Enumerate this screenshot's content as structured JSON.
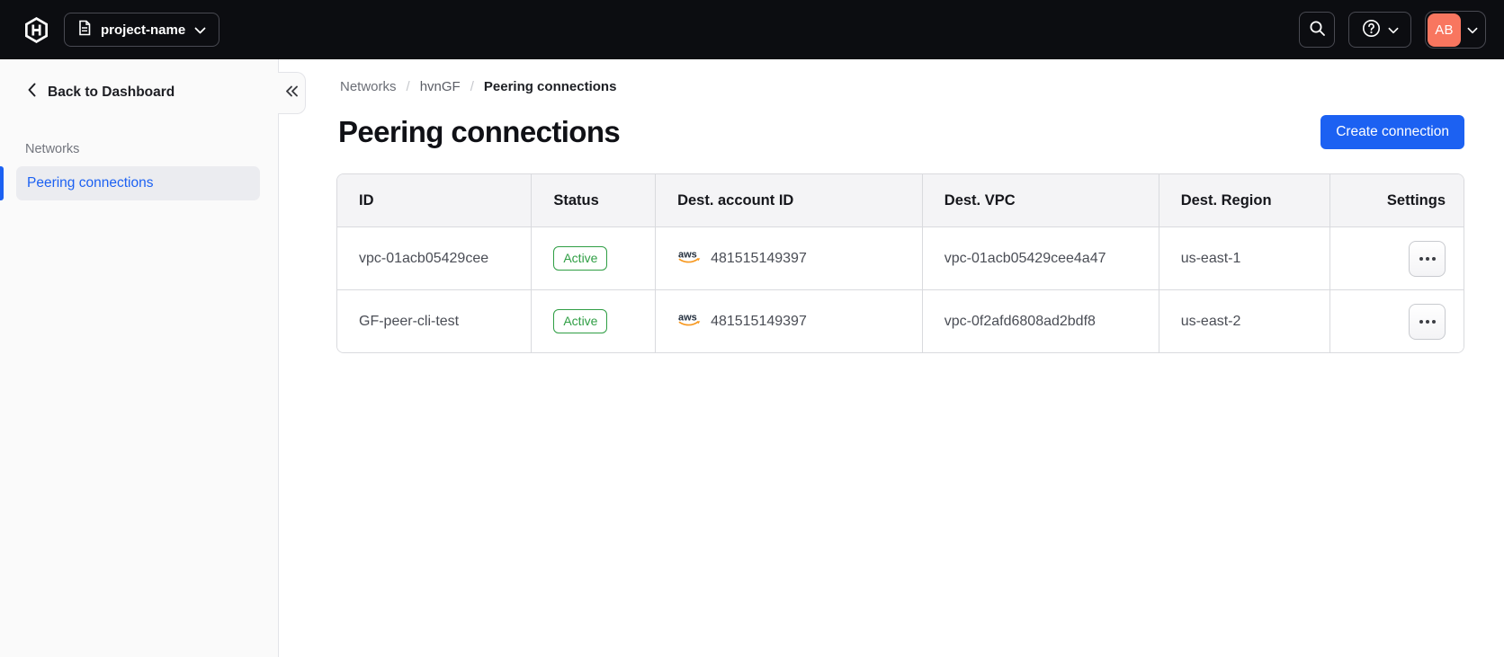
{
  "topbar": {
    "project_switcher_label": "project-name",
    "avatar_initials": "AB"
  },
  "sidebar": {
    "back_label": "Back to Dashboard",
    "section_label": "Networks",
    "active_item_label": "Peering connections"
  },
  "breadcrumb": {
    "items": [
      "Networks",
      "hvnGF",
      "Peering connections"
    ],
    "separator": "/"
  },
  "page": {
    "title": "Peering connections",
    "create_button_label": "Create connection"
  },
  "table": {
    "columns": [
      "ID",
      "Status",
      "Dest. account ID",
      "Dest. VPC",
      "Dest. Region",
      "Settings"
    ],
    "rows": [
      {
        "id": "vpc-01acb05429cee",
        "status": "Active",
        "dest_account_id": "481515149397",
        "dest_vpc": "vpc-01acb05429cee4a47",
        "dest_region": "us-east-1"
      },
      {
        "id": "GF-peer-cli-test",
        "status": "Active",
        "dest_account_id": "481515149397",
        "dest_vpc": "vpc-0f2afd6808ad2bdf8",
        "dest_region": "us-east-2"
      }
    ]
  },
  "icons": {
    "aws_label": "aws"
  },
  "colors": {
    "accent_blue": "#1c61f2",
    "success_green": "#2f9e44",
    "avatar_orange": "#f8765f",
    "aws_orange": "#f7981f",
    "topbar_bg": "#0c0d11"
  }
}
